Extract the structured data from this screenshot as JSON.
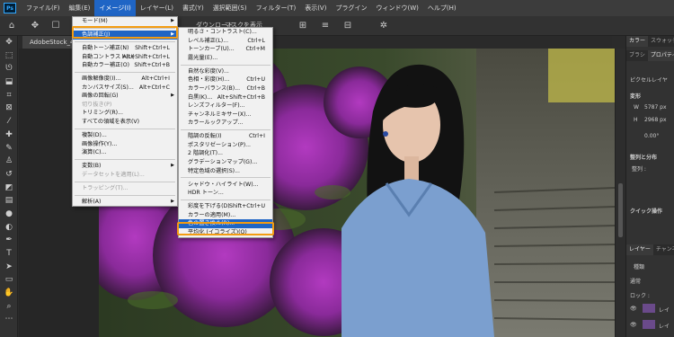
{
  "app": {
    "logo": "Ps"
  },
  "menubar": [
    "ファイル(F)",
    "編集(E)",
    "イメージ(I)",
    "レイヤー(L)",
    "書式(Y)",
    "選択範囲(S)",
    "フィルター(T)",
    "表示(V)",
    "プラグイン",
    "ウィンドウ(W)",
    "ヘルプ(H)"
  ],
  "optionsbar": {
    "text1": "ダウンロード",
    "text2": "マスクを表示"
  },
  "document": {
    "tab_label": "AdobeStock_4..."
  },
  "image_menu": {
    "items": [
      {
        "label": "モード(M)",
        "submenu": true
      },
      {
        "sep": true
      },
      {
        "label": "色調補正(J)",
        "submenu": true,
        "selected": true
      },
      {
        "sep": true
      },
      {
        "label": "自動トーン補正(N)",
        "shortcut": "Shift+Ctrl+L"
      },
      {
        "label": "自動コントラスト(U)",
        "shortcut": "Alt+Shift+Ctrl+L"
      },
      {
        "label": "自動カラー補正(O)",
        "shortcut": "Shift+Ctrl+B"
      },
      {
        "sep": true
      },
      {
        "label": "画像解像度(I)...",
        "shortcut": "Alt+Ctrl+I"
      },
      {
        "label": "カンバスサイズ(S)...",
        "shortcut": "Alt+Ctrl+C"
      },
      {
        "label": "画像の回転(G)",
        "submenu": true
      },
      {
        "label": "切り抜き(P)",
        "disabled": true
      },
      {
        "label": "トリミング(R)..."
      },
      {
        "label": "すべての領域を表示(V)"
      },
      {
        "sep": true
      },
      {
        "label": "複製(D)..."
      },
      {
        "label": "画像操作(Y)..."
      },
      {
        "label": "演算(C)..."
      },
      {
        "sep": true
      },
      {
        "label": "変数(B)",
        "submenu": true
      },
      {
        "label": "データセットを適用(L)...",
        "disabled": true
      },
      {
        "sep": true
      },
      {
        "label": "トラッピング(T)...",
        "disabled": true
      },
      {
        "sep": true
      },
      {
        "label": "解析(A)",
        "submenu": true
      }
    ]
  },
  "adjust_menu": {
    "items": [
      {
        "label": "明るさ・コントラスト(C)..."
      },
      {
        "label": "レベル補正(L)...",
        "shortcut": "Ctrl+L"
      },
      {
        "label": "トーンカーブ(U)...",
        "shortcut": "Ctrl+M"
      },
      {
        "label": "露光量(E)..."
      },
      {
        "sep": true
      },
      {
        "label": "自然な彩度(V)..."
      },
      {
        "label": "色相・彩度(H)...",
        "shortcut": "Ctrl+U"
      },
      {
        "label": "カラーバランス(B)...",
        "shortcut": "Ctrl+B"
      },
      {
        "label": "白黒(K)...",
        "shortcut": "Alt+Shift+Ctrl+B"
      },
      {
        "label": "レンズフィルター(F)..."
      },
      {
        "label": "チャンネルミキサー(X)..."
      },
      {
        "label": "カラールックアップ..."
      },
      {
        "sep": true
      },
      {
        "label": "階調の反転(I)",
        "shortcut": "Ctrl+I"
      },
      {
        "label": "ポスタリゼーション(P)..."
      },
      {
        "label": "2 階調化(T)..."
      },
      {
        "label": "グラデーションマップ(G)..."
      },
      {
        "label": "特定色域の選択(S)..."
      },
      {
        "sep": true
      },
      {
        "label": "シャドウ・ハイライト(W)..."
      },
      {
        "label": "HDR トーン..."
      },
      {
        "sep": true
      },
      {
        "label": "彩度を下げる(D)",
        "shortcut": "Shift+Ctrl+U"
      },
      {
        "label": "カラーの適用(M)..."
      },
      {
        "label": "色の置き換え(R)...",
        "selected": true
      },
      {
        "label": "平均化 (イコライズ)(Q)"
      }
    ]
  },
  "panels": {
    "top_tabs": [
      "カラー",
      "スウォッチ"
    ],
    "sub_tabs": [
      "ブラシ",
      "プロパティ"
    ],
    "props_row": "ピクセルレイヤ",
    "transform_title": "変形",
    "w_label": "W",
    "w_value": "5787 px",
    "h_label": "H",
    "h_value": "2968 px",
    "angle_value": "0.00°",
    "align_title": "整列と分布",
    "align_sub": "整列 :",
    "quick_title": "クイック操作",
    "layer_tabs": [
      "レイヤー",
      "チャンネル"
    ],
    "layer_search": "種類",
    "blend_mode": "通常",
    "lock_label": "ロック :",
    "layer_names": [
      "レイ",
      "レイ"
    ]
  },
  "colors": {
    "accent_blue": "#1f65c5",
    "highlight_orange": "#f39c12"
  }
}
